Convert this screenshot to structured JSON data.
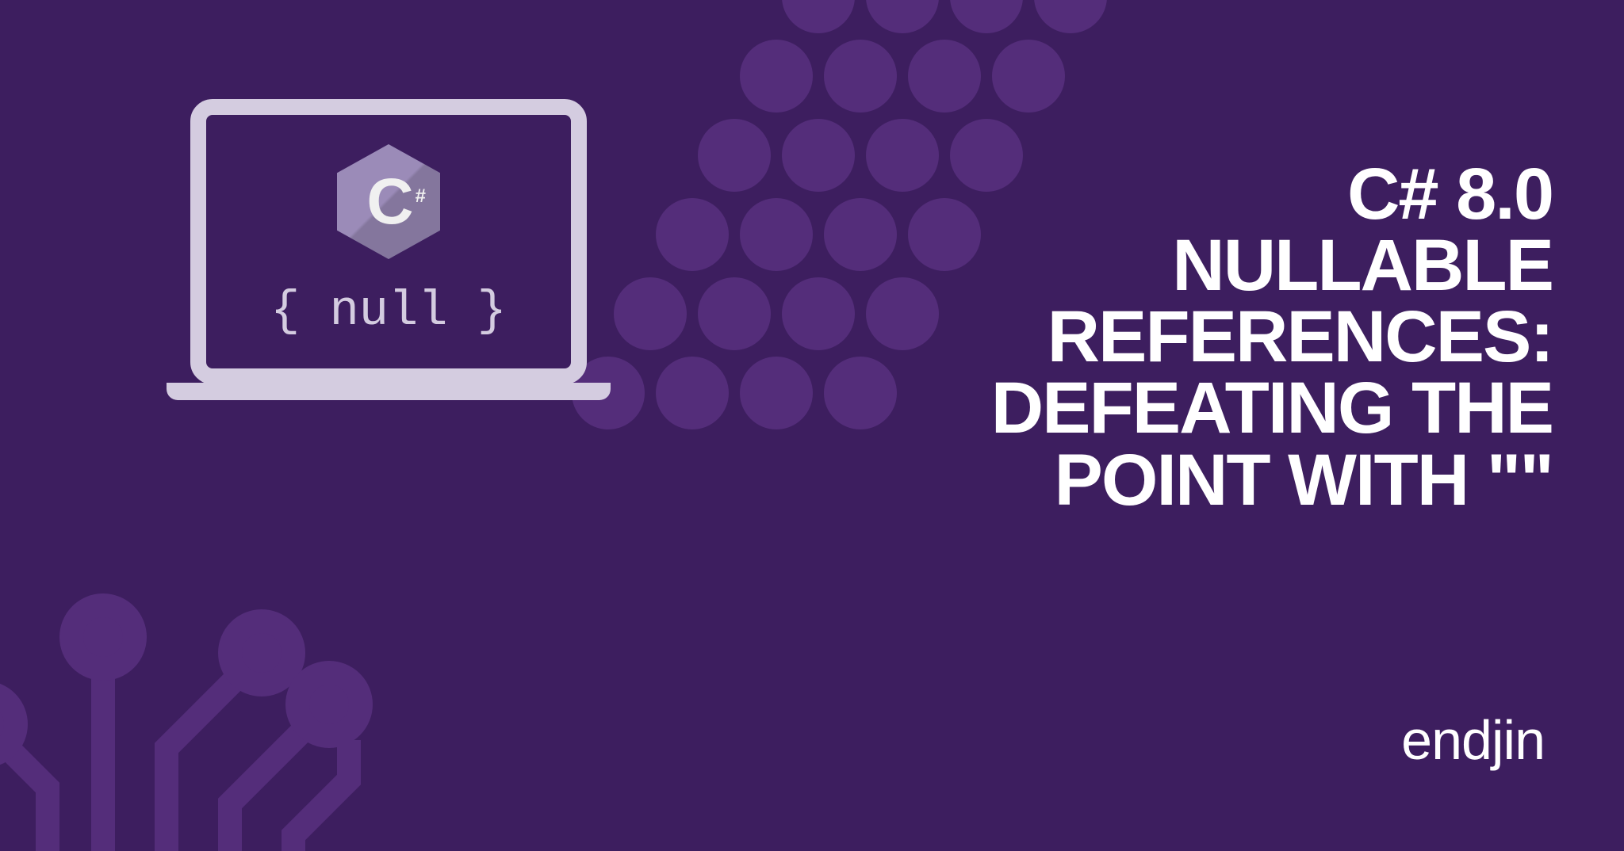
{
  "headline": {
    "line1": "C# 8.0",
    "line2": "NULLABLE",
    "line3": "REFERENCES:",
    "line4": "DEFEATING THE",
    "line5": "POINT WITH \"\""
  },
  "laptop": {
    "null_label": "{ null }",
    "logo_letter": "C",
    "logo_hash": "#"
  },
  "brand": "endjin",
  "colors": {
    "background": "#3d1e5f",
    "accent": "#542d7a",
    "light": "#d4cce0",
    "text": "#ffffff"
  }
}
